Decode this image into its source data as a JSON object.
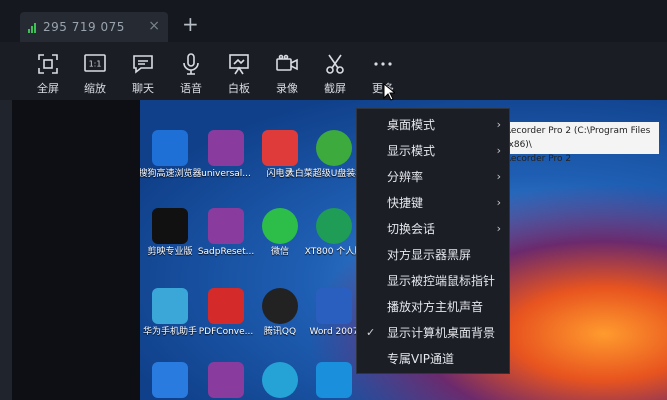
{
  "tab": {
    "title": "295 719 075",
    "close": "×"
  },
  "new_tab": "+",
  "toolbar": {
    "items": [
      {
        "label": "全屏",
        "icon": "fullscreen-icon"
      },
      {
        "label": "缩放",
        "icon": "scale-icon"
      },
      {
        "label": "聊天",
        "icon": "chat-icon"
      },
      {
        "label": "语音",
        "icon": "microphone-icon"
      },
      {
        "label": "白板",
        "icon": "whiteboard-icon"
      },
      {
        "label": "录像",
        "icon": "video-camera-icon"
      },
      {
        "label": "截屏",
        "icon": "scissors-icon"
      },
      {
        "label": "更多",
        "icon": "more-icon"
      }
    ],
    "scale_badge": "1:1"
  },
  "remote_desktop": {
    "icons": [
      {
        "name": "搜狗高速浏览器"
      },
      {
        "name": "universal..."
      },
      {
        "name": "闪电录"
      },
      {
        "name": "大白菜超级U盘装机工具"
      },
      {
        "name": "剪映专业版"
      },
      {
        "name": "SadpReset..."
      },
      {
        "name": "微信"
      },
      {
        "name": "XT800 个人版"
      },
      {
        "name": "华为手机助手"
      },
      {
        "name": "PDFConve..."
      },
      {
        "name": "腾讯QQ"
      },
      {
        "name": "Word 2007"
      }
    ],
    "tooltip_line1": "Recorder Pro 2 (C:\\Program Files (x86)\\",
    "tooltip_line2": "Recorder Pro 2"
  },
  "menu": {
    "items": [
      {
        "label": "桌面模式",
        "submenu": "›"
      },
      {
        "label": "显示模式",
        "submenu": "›"
      },
      {
        "label": "分辨率",
        "submenu": "›"
      },
      {
        "label": "快捷键",
        "submenu": "›"
      },
      {
        "label": "切换会话",
        "submenu": "›"
      },
      {
        "label": "对方显示器黑屏"
      },
      {
        "label": "显示被控端鼠标指针"
      },
      {
        "label": "播放对方主机声音"
      },
      {
        "label": "显示计算机桌面背景",
        "check": "✓"
      },
      {
        "label": "专属VIP通道"
      }
    ]
  },
  "colors": {
    "accent": "#3fbf5a",
    "toolbar_bg": "#1a1d24",
    "menu_bg": "#1b1e25"
  }
}
